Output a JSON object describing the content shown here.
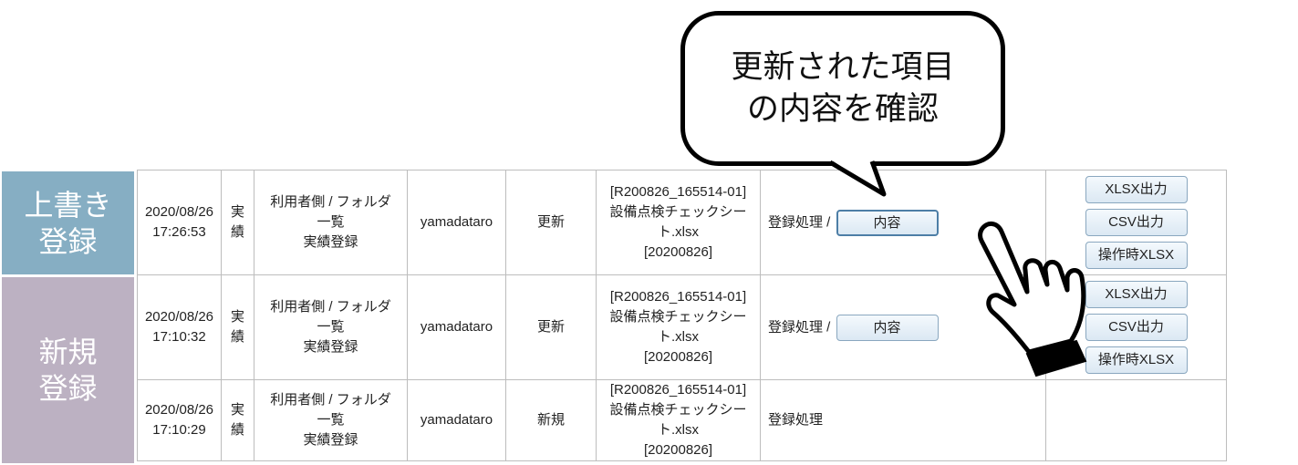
{
  "side_labels": {
    "overwrite": [
      "上書き",
      "登録"
    ],
    "new": [
      "新規",
      "登録"
    ]
  },
  "callout": {
    "lines": [
      "更新された項目",
      "の内容を確認"
    ]
  },
  "log_rows": [
    {
      "datetime": [
        "2020/08/26",
        "17:26:53"
      ],
      "kind": "実績",
      "screen": [
        "利用者側 / フォルダ",
        "一覧",
        "実績登録"
      ],
      "user": "yamadataro",
      "operation": "更新",
      "file": [
        "[R200826_165514-01]",
        "設備点検チェックシー",
        "ト.xlsx",
        "[20200826]"
      ],
      "process": "登録処理 / ",
      "content_button": "内容",
      "export_buttons": [
        "XLSX出力",
        "CSV出力",
        "操作時XLSX"
      ]
    },
    {
      "datetime": [
        "2020/08/26",
        "17:10:32"
      ],
      "kind": "実績",
      "screen": [
        "利用者側 / フォルダ",
        "一覧",
        "実績登録"
      ],
      "user": "yamadataro",
      "operation": "更新",
      "file": [
        "[R200826_165514-01]",
        "設備点検チェックシー",
        "ト.xlsx",
        "[20200826]"
      ],
      "process": "登録処理 / ",
      "content_button": "内容",
      "export_buttons": [
        "XLSX出力",
        "CSV出力",
        "操作時XLSX"
      ]
    },
    {
      "datetime": [
        "2020/08/26",
        "17:10:29"
      ],
      "kind": "実績",
      "screen": [
        "利用者側 / フォルダ",
        "一覧",
        "実績登録"
      ],
      "user": "yamadataro",
      "operation": "新規",
      "file": [
        "[R200826_165514-01]",
        "設備点検チェックシー",
        "ト.xlsx",
        "[20200826]"
      ],
      "process": "登録処理"
    }
  ],
  "colors": {
    "overwrite_label": "#86aec3",
    "new_label": "#bcb1c2",
    "button_border": "#8aa7bf"
  },
  "icons": {
    "pointer": "pointing-hand-icon"
  }
}
